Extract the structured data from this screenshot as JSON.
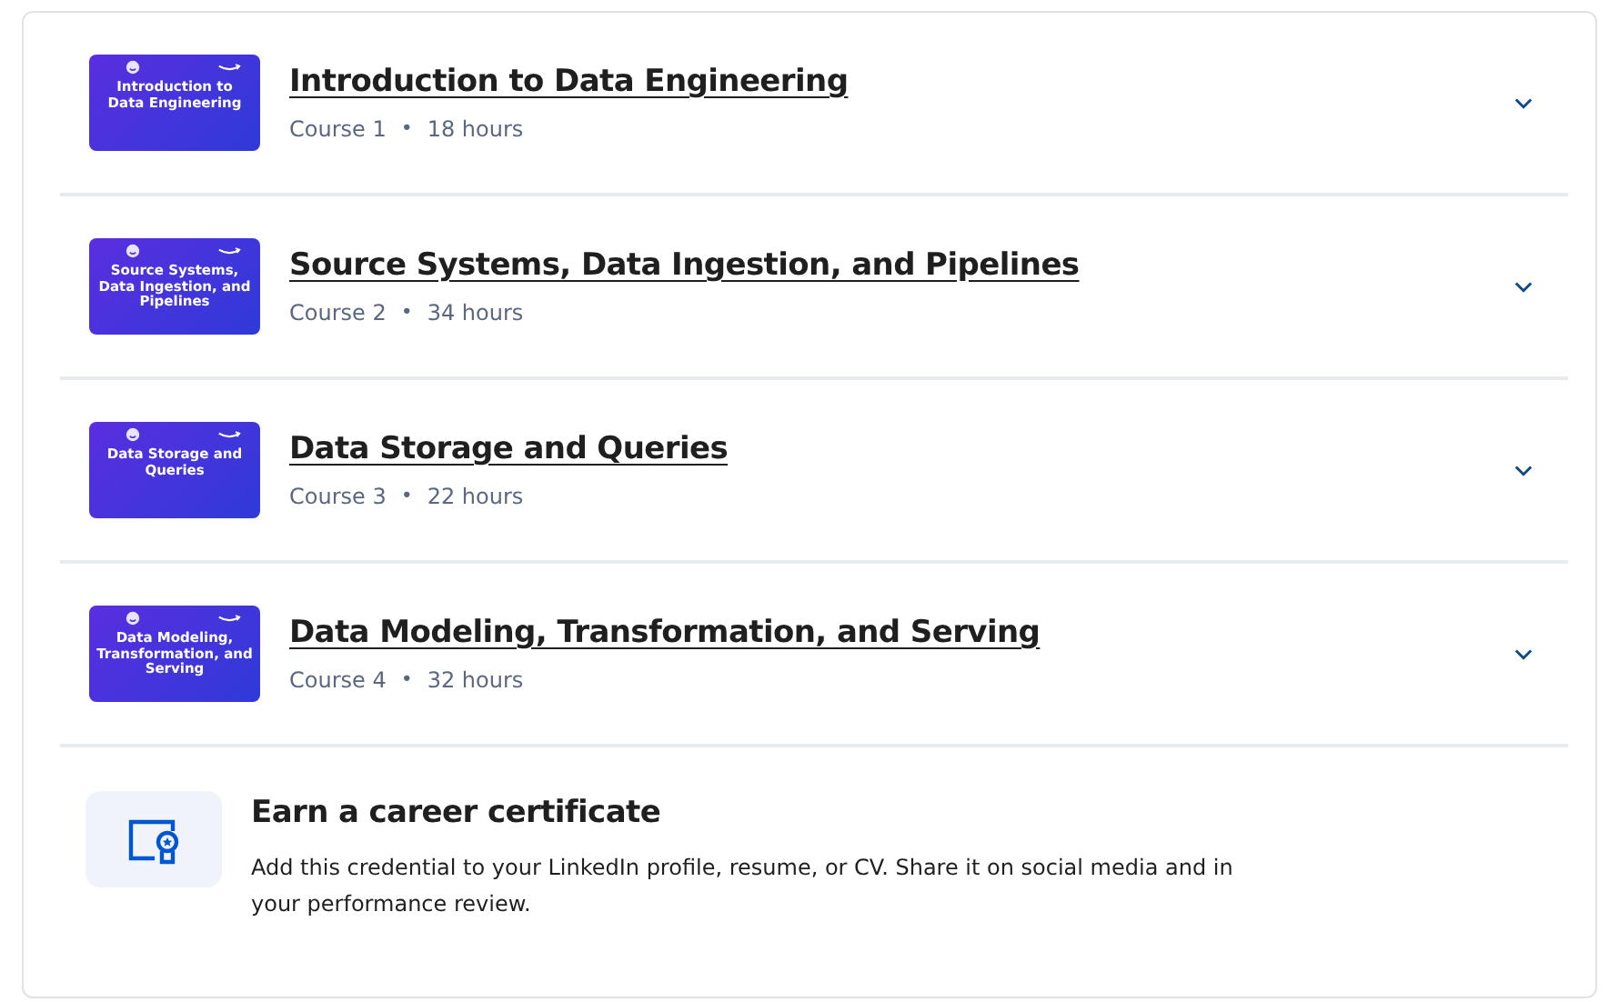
{
  "courses": [
    {
      "thumbnail_text": "Introduction to Data Engineering",
      "title": "Introduction to Data Engineering",
      "course": "Course 1",
      "duration": "18 hours",
      "expanded": false
    },
    {
      "thumbnail_text": "Source Systems, Data Ingestion, and Pipelines",
      "title": "Source Systems, Data Ingestion, and Pipelines",
      "course": "Course 2",
      "duration": "34 hours",
      "expanded": false
    },
    {
      "thumbnail_text": "Data Storage and Queries",
      "title": "Data Storage and Queries",
      "course": "Course 3",
      "duration": "22 hours",
      "expanded": false
    },
    {
      "thumbnail_text": "Data Modeling, Transformation, and Serving",
      "title": "Data Modeling, Transformation, and Serving",
      "course": "Course 4",
      "duration": "32 hours",
      "expanded": false
    }
  ],
  "separator": "•",
  "certificate": {
    "title": "Earn a career certificate",
    "description": "Add this credential to your LinkedIn profile, resume, or CV. Share it on social media and in your performance review."
  }
}
